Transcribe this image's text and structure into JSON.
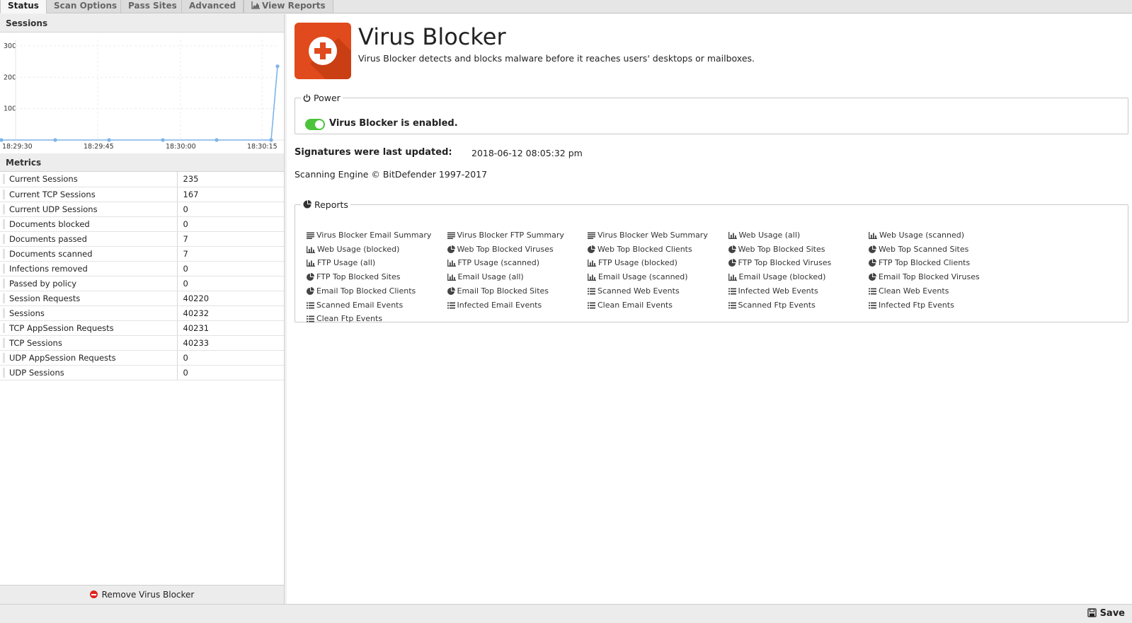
{
  "tabs": [
    {
      "label": "Status"
    },
    {
      "label": "Scan Options"
    },
    {
      "label": "Pass Sites"
    },
    {
      "label": "Advanced"
    },
    {
      "label": "View Reports"
    }
  ],
  "sessions_panel": {
    "title": "Sessions"
  },
  "chart_data": {
    "type": "line",
    "title": "",
    "x": [
      "18:29:30",
      "18:29:45",
      "18:30:00",
      "18:30:15"
    ],
    "ylim": [
      0,
      320
    ],
    "yticks": [
      100,
      200,
      300
    ],
    "series": [
      {
        "values": [
          0,
          0,
          0,
          0,
          0,
          0,
          235
        ]
      }
    ],
    "grid": true
  },
  "metrics_panel": {
    "title": "Metrics",
    "rows": [
      {
        "name": "Current Sessions",
        "value": "235"
      },
      {
        "name": "Current TCP Sessions",
        "value": "167"
      },
      {
        "name": "Current UDP Sessions",
        "value": "0"
      },
      {
        "name": "Documents blocked",
        "value": "0"
      },
      {
        "name": "Documents passed",
        "value": "7"
      },
      {
        "name": "Documents scanned",
        "value": "7"
      },
      {
        "name": "Infections removed",
        "value": "0"
      },
      {
        "name": "Passed by policy",
        "value": "0"
      },
      {
        "name": "Session Requests",
        "value": "40220"
      },
      {
        "name": "Sessions",
        "value": "40232"
      },
      {
        "name": "TCP AppSession Requests",
        "value": "40231"
      },
      {
        "name": "TCP Sessions",
        "value": "40233"
      },
      {
        "name": "UDP AppSession Requests",
        "value": "0"
      },
      {
        "name": "UDP Sessions",
        "value": "0"
      }
    ]
  },
  "remove_label": "Remove Virus Blocker",
  "app": {
    "title": "Virus Blocker",
    "description": "Virus Blocker detects and blocks malware before it reaches users' desktops or mailboxes.",
    "icon": "plus-shield-icon",
    "icon_color": "#e04a1c"
  },
  "power": {
    "legend": "Power",
    "status_text": "Virus Blocker is enabled.",
    "enabled": true,
    "toggle_color": "#4cc43a"
  },
  "signatures": {
    "label": "Signatures were last updated:",
    "value": "2018-06-12 08:05:32 pm"
  },
  "engine_text": "Scanning Engine © BitDefender 1997-2017",
  "reports": {
    "legend": "Reports",
    "items": [
      {
        "label": "Virus Blocker Email Summary",
        "icon": "text"
      },
      {
        "label": "Virus Blocker FTP Summary",
        "icon": "text"
      },
      {
        "label": "Virus Blocker Web Summary",
        "icon": "text"
      },
      {
        "label": "Web Usage (all)",
        "icon": "bar"
      },
      {
        "label": "Web Usage (scanned)",
        "icon": "bar"
      },
      {
        "label": "Web Usage (blocked)",
        "icon": "bar"
      },
      {
        "label": "Web Top Blocked Viruses",
        "icon": "pie"
      },
      {
        "label": "Web Top Blocked Clients",
        "icon": "pie"
      },
      {
        "label": "Web Top Blocked Sites",
        "icon": "pie"
      },
      {
        "label": "Web Top Scanned Sites",
        "icon": "pie"
      },
      {
        "label": "FTP Usage (all)",
        "icon": "bar"
      },
      {
        "label": "FTP Usage (scanned)",
        "icon": "bar"
      },
      {
        "label": "FTP Usage (blocked)",
        "icon": "bar"
      },
      {
        "label": "FTP Top Blocked Viruses",
        "icon": "pie"
      },
      {
        "label": "FTP Top Blocked Clients",
        "icon": "pie"
      },
      {
        "label": "FTP Top Blocked Sites",
        "icon": "pie"
      },
      {
        "label": "Email Usage (all)",
        "icon": "bar"
      },
      {
        "label": "Email Usage (scanned)",
        "icon": "bar"
      },
      {
        "label": "Email Usage (blocked)",
        "icon": "bar"
      },
      {
        "label": "Email Top Blocked Viruses",
        "icon": "pie"
      },
      {
        "label": "Email Top Blocked Clients",
        "icon": "pie"
      },
      {
        "label": "Email Top Blocked Sites",
        "icon": "pie"
      },
      {
        "label": "Scanned Web Events",
        "icon": "list"
      },
      {
        "label": "Infected Web Events",
        "icon": "list"
      },
      {
        "label": "Clean Web Events",
        "icon": "list"
      },
      {
        "label": "Scanned Email Events",
        "icon": "list"
      },
      {
        "label": "Infected Email Events",
        "icon": "list"
      },
      {
        "label": "Clean Email Events",
        "icon": "list"
      },
      {
        "label": "Scanned Ftp Events",
        "icon": "list"
      },
      {
        "label": "Infected Ftp Events",
        "icon": "list"
      },
      {
        "label": "Clean Ftp Events",
        "icon": "list"
      }
    ]
  },
  "footer": {
    "save_label": "Save"
  }
}
